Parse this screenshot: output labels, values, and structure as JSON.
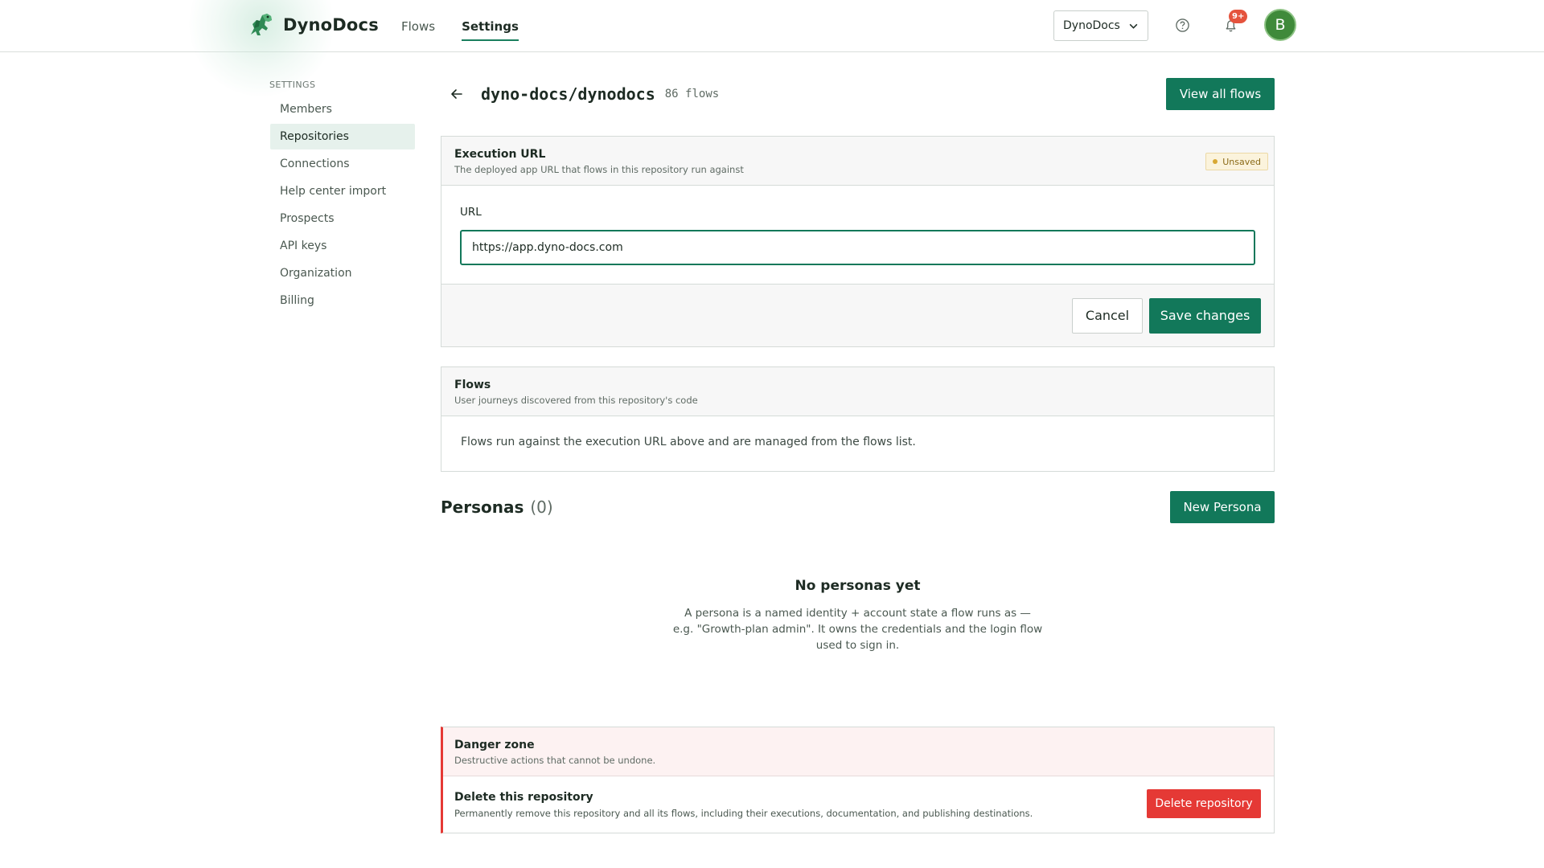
{
  "header": {
    "brand_name": "DynoDocs",
    "nav": [
      {
        "label": "Flows",
        "active": false
      },
      {
        "label": "Settings",
        "active": true
      }
    ],
    "org_selector": "DynoDocs",
    "notification_badge": "9+",
    "avatar_initial": "B"
  },
  "sidebar": {
    "heading": "SETTINGS",
    "items": [
      {
        "label": "Members"
      },
      {
        "label": "Repositories",
        "active": true
      },
      {
        "label": "Connections"
      },
      {
        "label": "Help center import"
      },
      {
        "label": "Prospects"
      },
      {
        "label": "API keys"
      },
      {
        "label": "Organization"
      },
      {
        "label": "Billing"
      }
    ]
  },
  "main": {
    "repo_title": "dyno-docs/dynodocs",
    "flow_count": "86 flows",
    "view_all_label": "View all flows",
    "execution": {
      "title": "Execution URL",
      "subtitle": "The deployed app URL that flows in this repository run against",
      "status": "Unsaved",
      "field_label": "URL",
      "url_value": "https://app.dyno-docs.com",
      "cancel_label": "Cancel",
      "save_label": "Save changes"
    },
    "flows": {
      "title": "Flows",
      "subtitle": "User journeys discovered from this repository's code",
      "body": "Flows run against the execution URL above and are managed from the flows list."
    },
    "personas": {
      "title": "Personas",
      "count": "(0)",
      "new_label": "New Persona",
      "empty_title": "No personas yet",
      "empty_text": "A persona is a named identity + account state a flow runs as — e.g. \"Growth-plan admin\". It owns the credentials and the login flow used to sign in."
    },
    "danger": {
      "title": "Danger zone",
      "subtitle": "Destructive actions that cannot be undone.",
      "row_title": "Delete this repository",
      "row_subtitle": "Permanently remove this repository and all its flows, including their executions, documentation, and publishing destinations.",
      "delete_label": "Delete repository"
    }
  },
  "colors": {
    "primary": "#12785a",
    "danger": "#e53935",
    "badge": "#e5533d",
    "active_bg": "#e6f1ec"
  }
}
